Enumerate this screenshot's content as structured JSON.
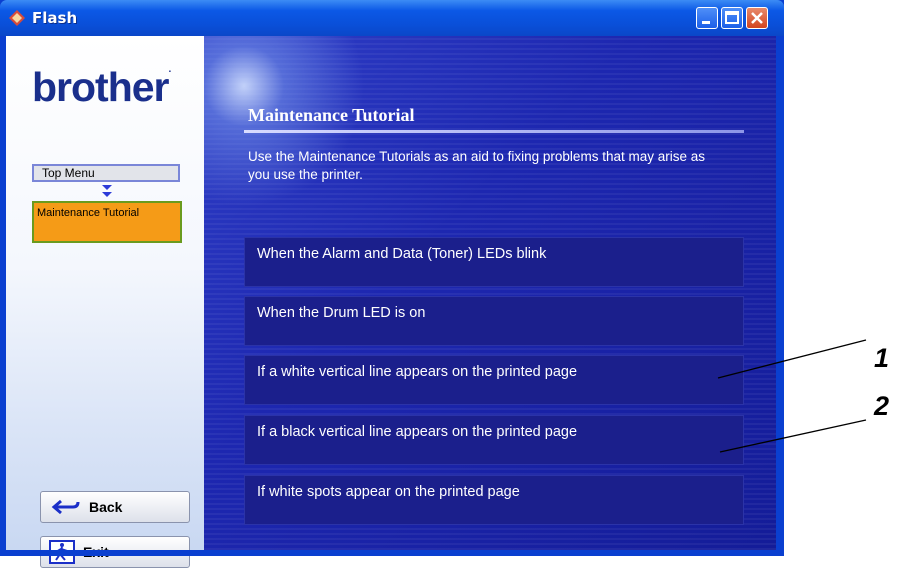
{
  "window": {
    "title": "Flash"
  },
  "logo": {
    "text": "brother"
  },
  "nav": {
    "top_menu": "Top Menu",
    "current": "Maintenance Tutorial"
  },
  "buttons": {
    "back": "Back",
    "exit": "Exit"
  },
  "main": {
    "title": "Maintenance Tutorial",
    "description": "Use the Maintenance Tutorials as an aid to fixing problems that may arise as you use the printer.",
    "topics": [
      "When the Alarm and Data (Toner) LEDs blink",
      "When the Drum LED is on",
      "If a white vertical line appears on the printed page",
      "If a black vertical line appears on the printed page",
      "If white spots appear on the printed page"
    ]
  },
  "callouts": [
    "1",
    "2"
  ],
  "colors": {
    "titlebar": "#0b58e6",
    "panel": "#1d27b0",
    "nav_current": "#f59b17"
  }
}
